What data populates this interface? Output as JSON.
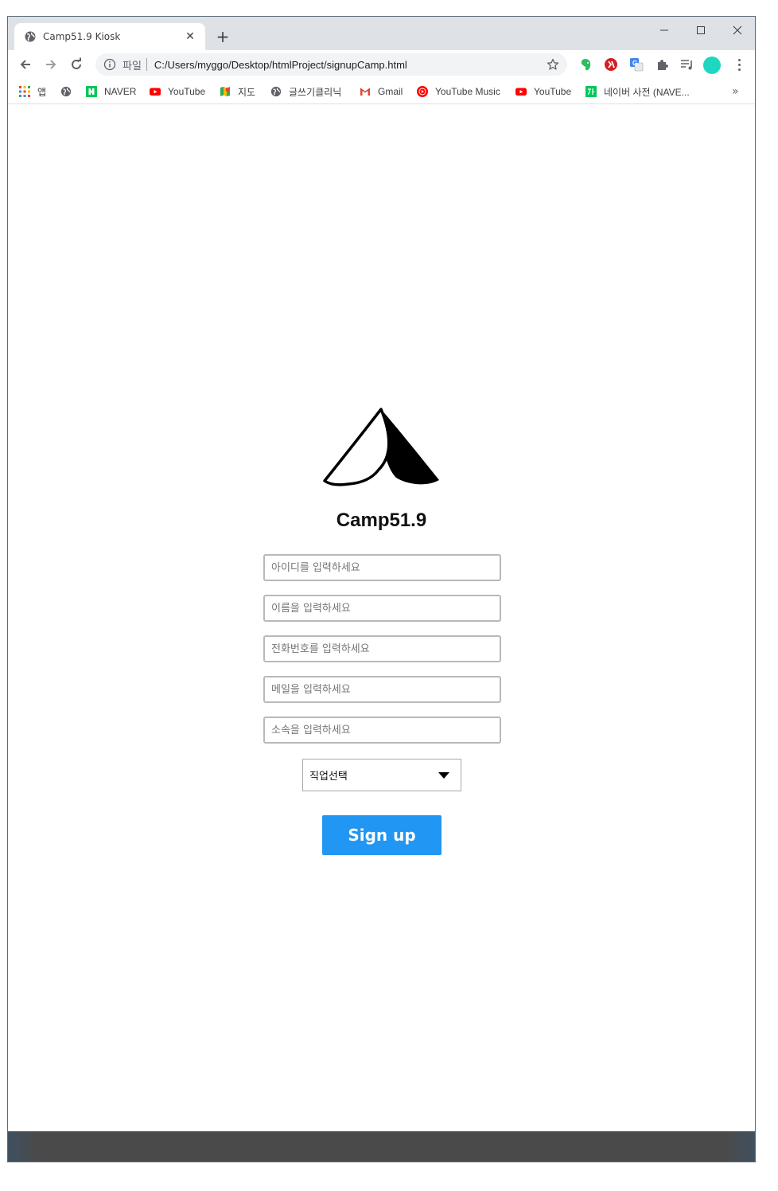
{
  "browser": {
    "tab": {
      "title": "Camp51.9 Kiosk"
    },
    "window_controls": {
      "minimize": "minimize",
      "maximize": "maximize",
      "close": "close"
    },
    "omnibox": {
      "scheme_label": "파일",
      "url": "C:/Users/myggo/Desktop/htmlProject/signupCamp.html"
    },
    "profile_color": "#1ed7c0",
    "bookmarks": [
      {
        "label": "앱",
        "icon": "apps-grid-icon"
      },
      {
        "label": "",
        "icon": "globe-icon"
      },
      {
        "label": "NAVER",
        "icon": "naver-icon"
      },
      {
        "label": "YouTube",
        "icon": "youtube-icon"
      },
      {
        "label": "지도",
        "icon": "maps-icon"
      },
      {
        "label": "글쓰기클리닉",
        "icon": "globe-icon"
      },
      {
        "label": "Gmail",
        "icon": "gmail-icon"
      },
      {
        "label": "YouTube Music",
        "icon": "youtube-music-icon"
      },
      {
        "label": "YouTube",
        "icon": "youtube-icon"
      },
      {
        "label": "네이버 사전 (NAVE...",
        "icon": "naver-dictionary-icon"
      }
    ],
    "bookmarks_overflow": "»"
  },
  "signup": {
    "brand": "Camp51.9",
    "fields": {
      "id_placeholder": "아이디를 입력하세요",
      "name_placeholder": "이름을 입력하세요",
      "phone_placeholder": "전화번호를 입력하세요",
      "email_placeholder": "메일을 입력하세요",
      "affiliation_placeholder": "소속을 입력하세요"
    },
    "job_select": {
      "selected": "직업선택"
    },
    "submit_label": "Sign up",
    "accent_color": "#2196f3"
  }
}
